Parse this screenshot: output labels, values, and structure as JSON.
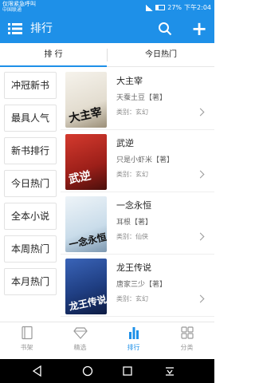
{
  "status": {
    "carrier_line1": "仅限紧急呼叫",
    "carrier_line2": "中国联通",
    "battery": "27%",
    "time": "下午2:04"
  },
  "appbar": {
    "title": "排行"
  },
  "tabs": [
    {
      "label": "排 行"
    },
    {
      "label": "今日热门"
    }
  ],
  "sidebar": {
    "items": [
      {
        "label": "冲冠新书"
      },
      {
        "label": "最具人气"
      },
      {
        "label": "新书排行"
      },
      {
        "label": "今日热门"
      },
      {
        "label": "全本小说"
      },
      {
        "label": "本周热门"
      },
      {
        "label": "本月热门"
      }
    ]
  },
  "books": [
    {
      "title": "大主宰",
      "author": "天蚕土豆【著】",
      "category": "类别：玄幻",
      "cover_text": "大主宰",
      "cover_color": "#f2eee6"
    },
    {
      "title": "武逆",
      "author": "只是小虾米【著】",
      "category": "类别：玄幻",
      "cover_text": "武逆",
      "cover_color": "#b62a22"
    },
    {
      "title": "一念永恒",
      "author": "耳根【著】",
      "category": "类别：仙侠",
      "cover_text": "一念永恒",
      "cover_color": "#d8e6ef"
    },
    {
      "title": "龙王传说",
      "author": "唐家三少【著】",
      "category": "类别：玄幻",
      "cover_text": "龙王传说",
      "cover_color": "#1f3e82"
    }
  ],
  "bottom_nav": [
    {
      "label": "书架",
      "icon": "bookshelf-icon"
    },
    {
      "label": "精选",
      "icon": "diamond-icon"
    },
    {
      "label": "排行",
      "icon": "bar-chart-icon",
      "active": true
    },
    {
      "label": "分类",
      "icon": "grid-icon"
    }
  ],
  "colors": {
    "primary": "#1e90e8",
    "text": "#222222",
    "muted": "#888888"
  }
}
